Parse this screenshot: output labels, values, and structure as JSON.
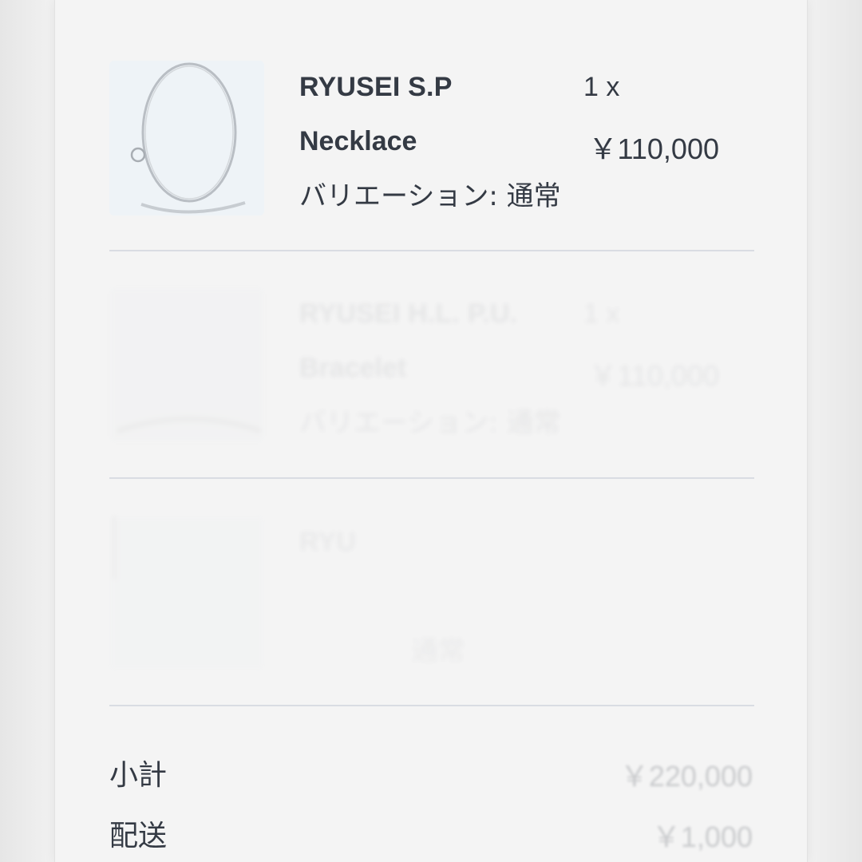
{
  "items": [
    {
      "brand": "RYUSEI S.P",
      "quantity": "1 x",
      "name": "Necklace",
      "price": "￥110,000",
      "variation": "バリエーション: 通常",
      "image_icon": "necklace-image"
    },
    {
      "brand": "RYUSEI H.L. P.U.",
      "quantity": "1 x",
      "name": "Bracelet",
      "price": "￥110,000",
      "variation": "バリエーション: 通常",
      "image_icon": "bracelet-image"
    },
    {
      "brand": "RYU",
      "quantity": "",
      "name": "",
      "price": "",
      "variation": "通常",
      "image_icon": "product-image"
    }
  ],
  "summary": {
    "subtotal_label": "小計",
    "subtotal_value": "￥220,000",
    "shipping_label": "配送",
    "shipping_value": "￥1,000"
  },
  "colors": {
    "text": "#343a44",
    "divider": "#d9dce3",
    "background": "#f4f4f4"
  }
}
